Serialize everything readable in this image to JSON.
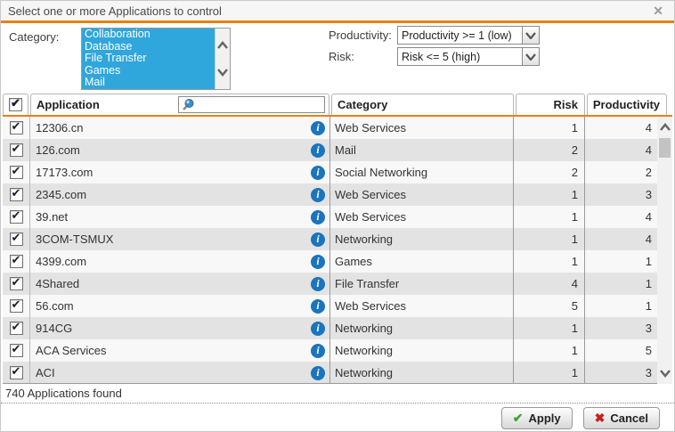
{
  "dialog": {
    "title": "Select one or more Applications to control",
    "close_glyph": "✕"
  },
  "filters": {
    "category_label": "Category:",
    "category_options": [
      "Collaboration",
      "Database",
      "File Transfer",
      "Games",
      "Mail"
    ],
    "productivity_label": "Productivity:",
    "productivity_value": "Productivity >= 1 (low)",
    "risk_label": "Risk:",
    "risk_value": "Risk <= 5 (high)"
  },
  "table": {
    "columns": {
      "application": "Application",
      "category": "Category",
      "risk": "Risk",
      "productivity": "Productivity"
    },
    "search_value": "",
    "info_glyph": "i",
    "rows": [
      {
        "application": "12306.cn",
        "category": "Web Services",
        "risk": "1",
        "productivity": "4"
      },
      {
        "application": "126.com",
        "category": "Mail",
        "risk": "2",
        "productivity": "4"
      },
      {
        "application": "17173.com",
        "category": "Social Networking",
        "risk": "2",
        "productivity": "2"
      },
      {
        "application": "2345.com",
        "category": "Web Services",
        "risk": "1",
        "productivity": "3"
      },
      {
        "application": "39.net",
        "category": "Web Services",
        "risk": "1",
        "productivity": "4"
      },
      {
        "application": "3COM-TSMUX",
        "category": "Networking",
        "risk": "1",
        "productivity": "4"
      },
      {
        "application": "4399.com",
        "category": "Games",
        "risk": "1",
        "productivity": "1"
      },
      {
        "application": "4Shared",
        "category": "File Transfer",
        "risk": "4",
        "productivity": "1"
      },
      {
        "application": "56.com",
        "category": "Web Services",
        "risk": "5",
        "productivity": "1"
      },
      {
        "application": "914CG",
        "category": "Networking",
        "risk": "1",
        "productivity": "3"
      },
      {
        "application": "ACA Services",
        "category": "Networking",
        "risk": "1",
        "productivity": "5"
      },
      {
        "application": "ACI",
        "category": "Networking",
        "risk": "1",
        "productivity": "3"
      }
    ]
  },
  "footer": {
    "status": "740 Applications found",
    "apply_label": "Apply",
    "cancel_label": "Cancel",
    "apply_glyph": "✔",
    "cancel_glyph": "✖"
  },
  "colors": {
    "accent_orange": "#e8820e",
    "selection_blue": "#2fa6dc",
    "info_blue": "#1b75bc",
    "apply_green": "#3ba334",
    "cancel_red": "#c4201f"
  }
}
